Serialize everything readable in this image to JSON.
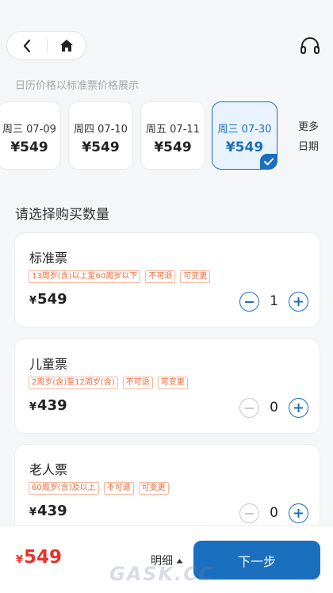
{
  "nav": {
    "back_icon": "chevron-left-icon",
    "home_icon": "home-icon",
    "service_icon": "headset-icon"
  },
  "hint": "日历价格以标准票价格展示",
  "dates": [
    {
      "label": "周三 07-09",
      "price": "¥549",
      "selected": false
    },
    {
      "label": "周四 07-10",
      "price": "¥549",
      "selected": false
    },
    {
      "label": "周五 07-11",
      "price": "¥549",
      "selected": false
    },
    {
      "label": "周三 07-30",
      "price": "¥549",
      "selected": true
    }
  ],
  "more": {
    "line1": "更多",
    "line2": "日期"
  },
  "section_title": "请选择购买数量",
  "tickets": [
    {
      "name": "标准票",
      "tags": [
        "13周岁(含)以上至60周岁以下",
        "不可退",
        "可变更"
      ],
      "currency": "¥",
      "price": "549",
      "qty": "1",
      "minus_enabled": true
    },
    {
      "name": "儿童票",
      "tags": [
        "2周岁(含)至12周岁(含)",
        "不可退",
        "可变更"
      ],
      "currency": "¥",
      "price": "439",
      "qty": "0",
      "minus_enabled": false
    },
    {
      "name": "老人票",
      "tags": [
        "60周岁(含)及以上",
        "不可退",
        "可变更"
      ],
      "currency": "¥",
      "price": "439",
      "qty": "0",
      "minus_enabled": false
    }
  ],
  "bottom": {
    "currency": "¥",
    "total": "549",
    "detail_label": "明细",
    "next_label": "下一步"
  },
  "watermark": "GASK.CC",
  "colors": {
    "accent": "#1a6fbe",
    "price_red": "#e8322b",
    "tag_orange": "#ef6a3a"
  }
}
